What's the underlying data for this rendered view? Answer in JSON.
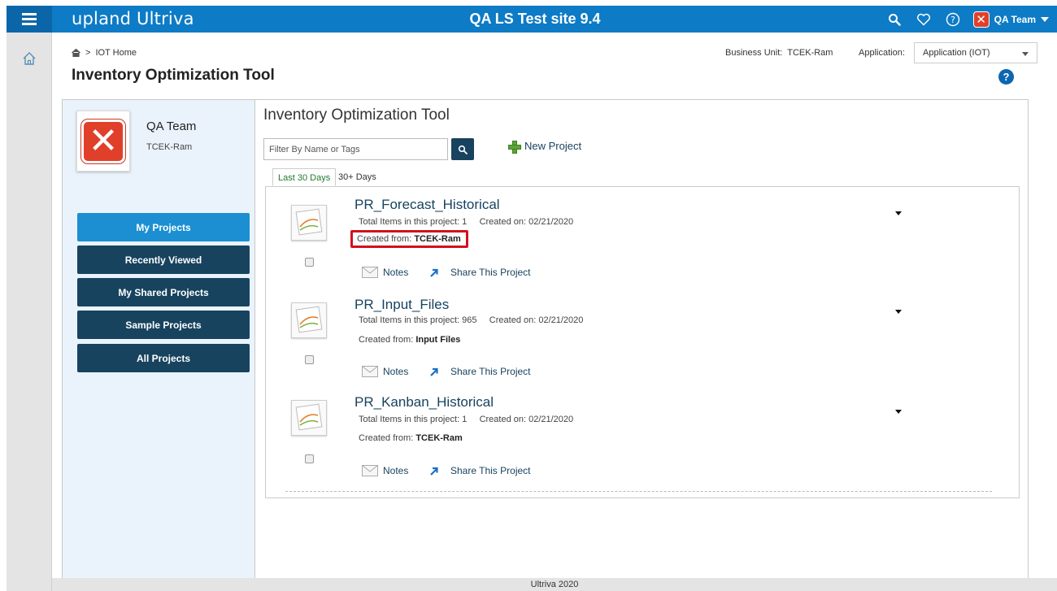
{
  "header": {
    "brand": "upland Ultriva",
    "site_title": "QA LS Test site 9.4",
    "team_label": "QA Team"
  },
  "breadcrumb": {
    "home": "IOT Home"
  },
  "page_title": "Inventory Optimization Tool",
  "business_unit": {
    "label": "Business Unit:",
    "value": "TCEK-Ram"
  },
  "application": {
    "label": "Application:",
    "selected": "Application (IOT)"
  },
  "profile": {
    "name": "QA Team",
    "bu": "TCEK-Ram"
  },
  "nav": [
    "My Projects",
    "Recently Viewed",
    "My Shared Projects",
    "Sample Projects",
    "All Projects"
  ],
  "main": {
    "title": "Inventory Optimization Tool",
    "filter_placeholder": "Filter By Name or Tags",
    "new_project": "New Project",
    "tabs": [
      "Last 30 Days",
      "30+ Days"
    ]
  },
  "projects": [
    {
      "name": "PR_Forecast_Historical",
      "items": "Total Items in this project: 1",
      "created_on": "Created on: 02/21/2020",
      "from_label": "Created from:",
      "from": "TCEK-Ram",
      "notes": "Notes",
      "share": "Share This Project"
    },
    {
      "name": "PR_Input_Files",
      "items": "Total Items in this project: 965",
      "created_on": "Created on: 02/21/2020",
      "from_label": "Created from:",
      "from": "Input Files",
      "notes": "Notes",
      "share": "Share This Project"
    },
    {
      "name": "PR_Kanban_Historical",
      "items": "Total Items in this project: 1",
      "created_on": "Created on: 02/21/2020",
      "from_label": "Created from:",
      "from": "TCEK-Ram",
      "notes": "Notes",
      "share": "Share This Project"
    }
  ],
  "footer": "Ultriva 2020",
  "colors": {
    "topbar": "#0d7bc6",
    "nav_dark": "#17435f",
    "nav_active": "#1b8fd1",
    "highlight": "#d4101e"
  },
  "icons": [
    "menu-icon",
    "search-icon",
    "heart-icon",
    "help-circle-icon",
    "error-x-icon",
    "home-icon",
    "plus-icon",
    "envelope-icon",
    "share-arrow-icon",
    "chart-icon"
  ]
}
